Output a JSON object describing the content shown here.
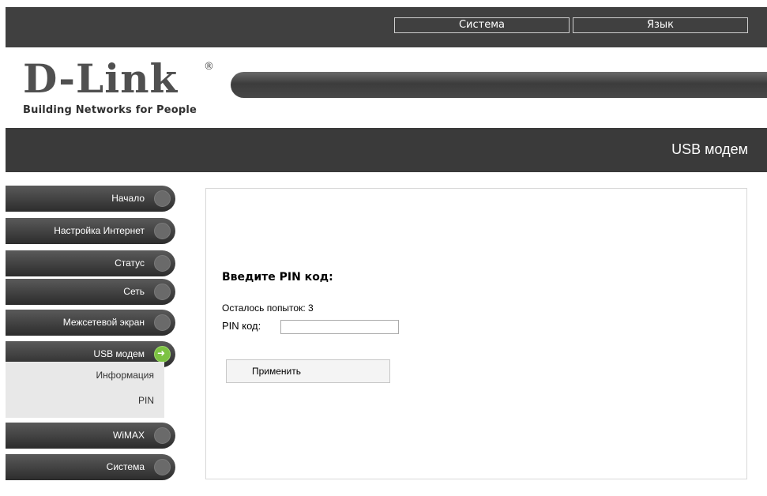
{
  "top_menu": {
    "system": "Система",
    "language": "Язык"
  },
  "logo": {
    "brand": "D-Link",
    "registered": "®",
    "tagline": "Building Networks for People"
  },
  "page_title": "USB модем",
  "sidebar": {
    "items": [
      {
        "label": "Начало",
        "active": false
      },
      {
        "label": "Настройка Интернет",
        "active": false
      },
      {
        "label": "Статус",
        "active": false
      },
      {
        "label": "Сеть",
        "active": false
      },
      {
        "label": "Межсетевой экран",
        "active": false
      },
      {
        "label": "USB модем",
        "active": true
      },
      {
        "label": "WiMAX",
        "active": false
      },
      {
        "label": "Система",
        "active": false
      }
    ],
    "subitems": [
      "Информация",
      "PIN"
    ]
  },
  "form": {
    "heading": "Введите PIN код:",
    "attempts_text": "Осталось попыток: 3",
    "pin_label": "PIN код:",
    "pin_value": "",
    "apply_label": "Применить"
  },
  "colors": {
    "active_indicator": "#7cc242",
    "header_bg": "#404040"
  }
}
